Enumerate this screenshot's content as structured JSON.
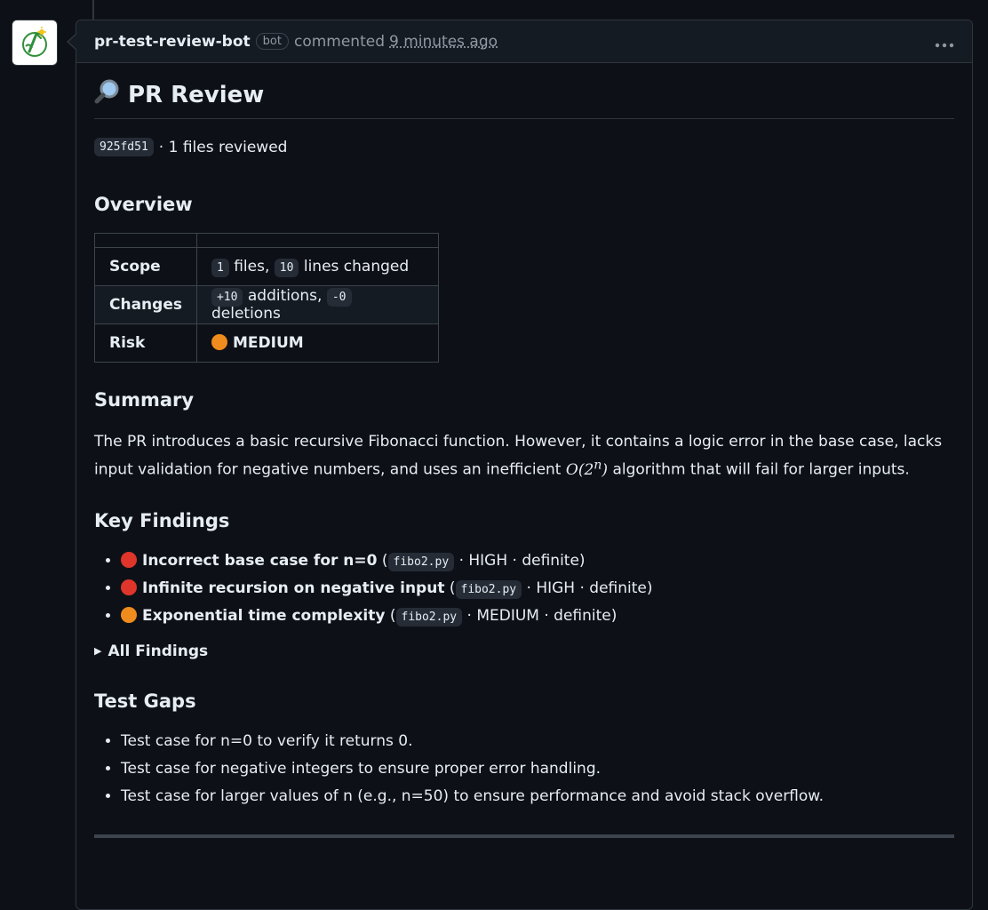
{
  "comment": {
    "author": "pr-test-review-bot",
    "badge": "bot",
    "action": "commented",
    "time": "9 minutes ago",
    "menu_icon": "kebab-horizontal-icon",
    "avatar_icon": "bot-avatar-icon"
  },
  "review": {
    "icon": "magnifying-glass-icon",
    "title": "PR Review",
    "commit": "925fd51",
    "files_text": "· 1 files reviewed",
    "overview": {
      "heading": "Overview",
      "scope_label": "Scope",
      "scope_files": "1",
      "scope_files_text": "files,",
      "scope_lines": "10",
      "scope_lines_text": "lines changed",
      "changes_label": "Changes",
      "additions": "+10",
      "additions_text": "additions,",
      "deletions": "-0",
      "deletions_text": "deletions",
      "risk_label": "Risk",
      "risk_value": "MEDIUM",
      "risk_color": "#f08b1d"
    },
    "summary": {
      "heading": "Summary",
      "text_before": "The PR introduces a basic recursive Fibonacci function. However, it contains a logic error in the base case, lacks input validation for negative numbers, and uses an inefficient",
      "math_base": "O(2",
      "math_exp": "n",
      "math_close": ")",
      "text_after": "algorithm that will fail for larger inputs."
    },
    "key_findings": {
      "heading": "Key Findings",
      "items": [
        {
          "severity_color": "#e0352b",
          "title": "Incorrect base case for n=0",
          "open": "(",
          "file": "fibo2.py",
          "meta": "· HIGH · definite)"
        },
        {
          "severity_color": "#e0352b",
          "title": "Infinite recursion on negative input",
          "open": "(",
          "file": "fibo2.py",
          "meta": "· HIGH · definite)"
        },
        {
          "severity_color": "#f08b1d",
          "title": "Exponential time complexity",
          "open": "(",
          "file": "fibo2.py",
          "meta": "· MEDIUM · definite)"
        }
      ]
    },
    "all_findings": {
      "toggle_icon": "triangle-right-icon",
      "label": "All Findings"
    },
    "test_gaps": {
      "heading": "Test Gaps",
      "items": [
        "Test case for n=0 to verify it returns 0.",
        "Test case for negative integers to ensure proper error handling.",
        "Test case for larger values of n (e.g., n=50) to ensure performance and avoid stack overflow."
      ]
    }
  }
}
